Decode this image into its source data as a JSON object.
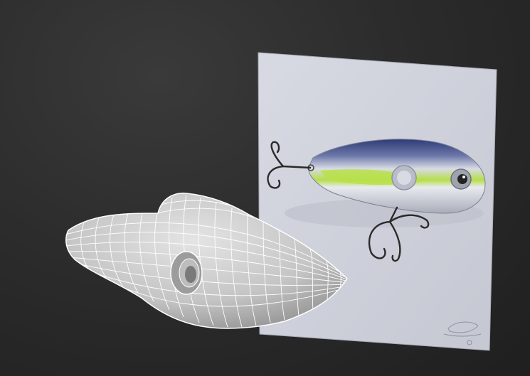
{
  "viewport": {
    "background_top": "#3a3a3a",
    "background_bottom": "#1f1f1f"
  },
  "reference_plane": {
    "color": "#d8d9e3",
    "edge_color": "#bfc1cc"
  },
  "lure_photo": {
    "body_silver": "#c9ccd4",
    "back_blue": "#3b4a86",
    "side_lime": "#b8e04a",
    "hook_color": "#2a2a2a",
    "signature_logo": "stamp"
  },
  "mesh_model": {
    "surface_color": "#d4d4d4",
    "shadow_color": "#8a8a8a",
    "wire_color": "#ffffff"
  }
}
